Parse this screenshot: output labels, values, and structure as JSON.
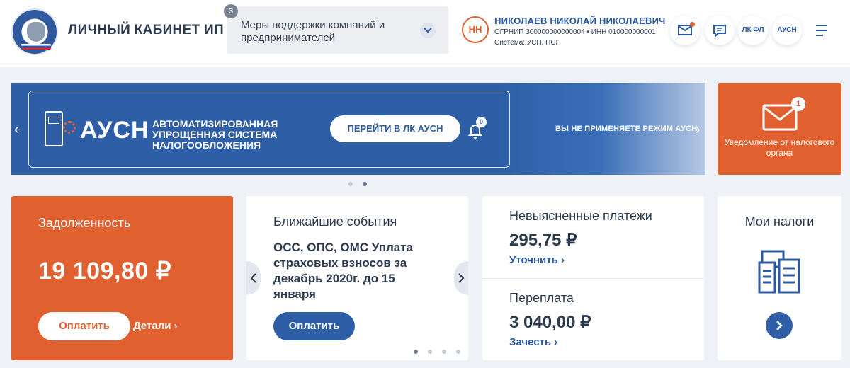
{
  "header": {
    "brand": "ЛИЧНЫЙ КАБИНЕТ ИП",
    "support_count": "3",
    "support_label": "Меры поддержки компаний и предпринимателей",
    "avatar_initials": "НН",
    "user_name": "НИКОЛАЕВ НИКОЛАЙ НИКОЛАЕВИЧ",
    "user_ids": "ОГРНИП 300000000000004 • ИНН 010000000001",
    "user_system": "Система: УСН, ПСН",
    "lk_fl": "ЛК ФЛ",
    "ausn": "АУСН"
  },
  "banner": {
    "logo_text": "АУСН",
    "description": "АВТОМАТИЗИРОВАННАЯ УПРОЩЕННАЯ СИСТЕМА НАЛОГООБЛОЖЕНИЯ",
    "button": "ПЕРЕЙТИ В ЛК АУСН",
    "bell_count": "0",
    "side_text": "ВЫ НЕ ПРИМЕНЯЕТЕ РЕЖИМ АУСН",
    "left_arrow": "‹",
    "right_arrow": "›"
  },
  "notification": {
    "count": "1",
    "text": "Уведомление от налогового органа"
  },
  "debt": {
    "title": "Задолженность",
    "amount": "19 109,80 ₽",
    "pay_button": "Оплатить",
    "details_link": "Детали ›"
  },
  "events": {
    "title": "Ближайшие события",
    "text": "ОСС, ОПС, ОМС Уплата страховых взносов за декабрь 2020г. до 15 января",
    "pay_button": "Оплатить"
  },
  "payments": {
    "title": "Невыясненные платежи",
    "amount": "295,75 ₽",
    "link": "Уточнить ›",
    "over_title": "Переплата",
    "over_amount": "3 040,00 ₽",
    "over_link": "Зачесть ›"
  },
  "taxes": {
    "title": "Мои налоги"
  },
  "colors": {
    "accent_orange": "#e0612f",
    "accent_blue": "#2e5fa6"
  }
}
